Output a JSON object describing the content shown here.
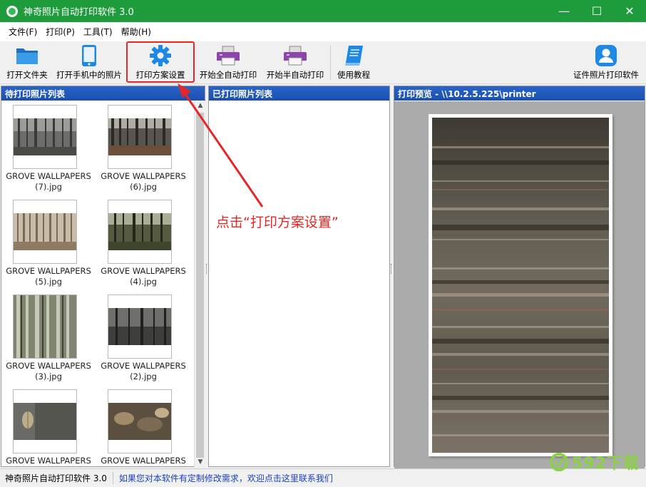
{
  "window": {
    "title": "神奇照片自动打印软件 3.0",
    "minimize_glyph": "—",
    "maximize_glyph": "☐",
    "close_glyph": "✕"
  },
  "menu": [
    "文件(F)",
    "打印(P)",
    "工具(T)",
    "帮助(H)"
  ],
  "toolbar": {
    "open_folder": "打开文件夹",
    "open_phone": "打开手机中的照片",
    "print_settings": "打印方案设置",
    "start_auto": "开始全自动打印",
    "start_semi": "开始半自动打印",
    "tutorial": "使用教程",
    "id_photo": "证件照片打印软件"
  },
  "panels": {
    "pending_title": "待打印照片列表",
    "printed_title": "已打印照片列表",
    "preview_title": "打印预览 - \\\\10.2.5.225\\printer"
  },
  "photos": [
    {
      "name": "GROVE WALLPAPERS (7).jpg",
      "line1": "GROVE WALLPAPERS",
      "line2": "(7).jpg"
    },
    {
      "name": "GROVE WALLPAPERS (6).jpg",
      "line1": "GROVE WALLPAPERS",
      "line2": "(6).jpg"
    },
    {
      "name": "GROVE WALLPAPERS (5).jpg",
      "line1": "GROVE WALLPAPERS",
      "line2": "(5).jpg"
    },
    {
      "name": "GROVE WALLPAPERS (4).jpg",
      "line1": "GROVE WALLPAPERS",
      "line2": "(4).jpg"
    },
    {
      "name": "GROVE WALLPAPERS (3).jpg",
      "line1": "GROVE WALLPAPERS",
      "line2": "(3).jpg"
    },
    {
      "name": "GROVE WALLPAPERS (2).jpg",
      "line1": "GROVE WALLPAPERS",
      "line2": "(2).jpg"
    },
    {
      "name": "GROVE WALLPAPERS",
      "line1": "GROVE WALLPAPERS",
      "line2": ""
    },
    {
      "name": "GROVE WALLPAPERS",
      "line1": "GROVE WALLPAPERS",
      "line2": ""
    }
  ],
  "annotation": "点击“打印方案设置”",
  "status": {
    "app_version": "神奇照片自动打印软件 3.0",
    "custom_link": "如果您对本软件有定制修改需求，欢迎点击这里联系我们"
  },
  "watermark": {
    "text": "592下载",
    "url": "www.592xz.com"
  },
  "colors": {
    "titlebar": "#1e9c3b",
    "panel_header": "#2a64c8",
    "highlight": "#e52727",
    "toolbar_blue": "#1e88e5",
    "printer_purple": "#8e44ad",
    "link": "#1a3fbf"
  }
}
